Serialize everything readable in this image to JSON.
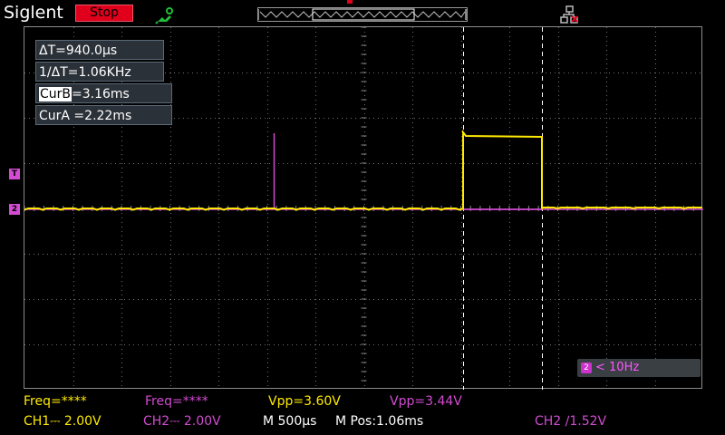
{
  "header": {
    "brand": "Siglent",
    "run_state": "Stop",
    "trigger_pos_marker": "T"
  },
  "icons": {
    "probe": "usb-probe-icon",
    "network": "network-icon"
  },
  "cursor_readouts": {
    "delta_t": "ΔT=940.0µs",
    "inv_delta_t": "1/ΔT=1.06KHz",
    "cur_b_label": "CurB",
    "cur_b_value": "=3.16ms",
    "cur_a": "CurA =2.22ms"
  },
  "trace_markers": {
    "trigger_level": "T",
    "ch2_ground": "2"
  },
  "frequency_badge": {
    "channel": "2",
    "text": "< 10Hz"
  },
  "measurements": {
    "ch1_freq": "Freq=****",
    "ch2_freq": "Freq=****",
    "ch1_vpp": "Vpp=3.60V",
    "ch2_vpp": "Vpp=3.44V"
  },
  "status_bar": {
    "ch1_scale": "CH1⎓ 2.00V",
    "ch2_scale": "CH2⎓ 2.00V",
    "timebase": "M 500µs",
    "mpos": "M Pos:1.06ms",
    "trigger": "CH2 ∕1.52V"
  },
  "colors": {
    "ch1": "#ffea00",
    "ch2": "#d24bd2",
    "stop": "#e0001b",
    "grid": "#8a8a8a"
  }
}
